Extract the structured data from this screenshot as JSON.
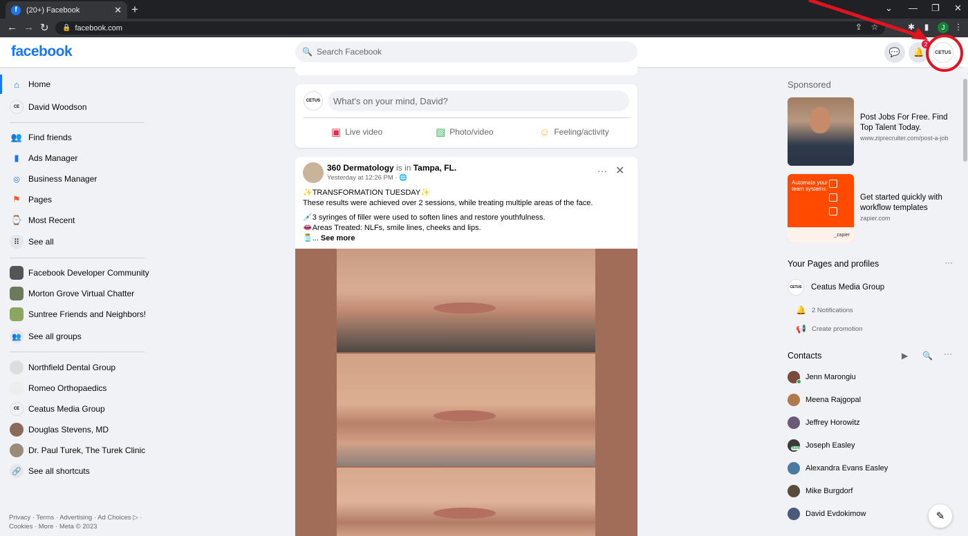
{
  "browser": {
    "tab_title": "(20+) Facebook",
    "tab_favicon": "f",
    "tab_close": "✕",
    "new_tab": "+",
    "url": "facebook.com",
    "profile_initial": "J"
  },
  "header": {
    "logo": "facebook",
    "search_placeholder": "Search Facebook",
    "notif_count": "2",
    "account_avatar_text": "CETUS"
  },
  "left_nav": {
    "items": [
      {
        "label": "Home",
        "icon": "home-icon"
      },
      {
        "label": "David Woodson",
        "icon": "avatar"
      },
      {
        "label": "Find friends",
        "icon": "friends-icon"
      },
      {
        "label": "Ads Manager",
        "icon": "ads-manager-icon"
      },
      {
        "label": "Business Manager",
        "icon": "business-manager-icon"
      },
      {
        "label": "Pages",
        "icon": "pages-flag-icon"
      },
      {
        "label": "Most Recent",
        "icon": "most-recent-icon"
      },
      {
        "label": "See all",
        "icon": "grid-icon"
      }
    ],
    "groups": [
      {
        "label": "Facebook Developer Community"
      },
      {
        "label": "Morton Grove Virtual Chatter"
      },
      {
        "label": "Suntree Friends and Neighbors!"
      },
      {
        "label": "See all groups"
      }
    ],
    "shortcuts": [
      {
        "label": "Northfield Dental Group"
      },
      {
        "label": "Romeo Orthopaedics"
      },
      {
        "label": "Ceatus Media Group"
      },
      {
        "label": "Douglas Stevens, MD"
      },
      {
        "label": "Dr. Paul Turek, The Turek Clinic"
      },
      {
        "label": "See all shortcuts"
      }
    ],
    "footer": "Privacy · Terms · Advertising · Ad Choices ▷ · Cookies · More · Meta © 2023"
  },
  "composer": {
    "avatar_text": "CETUS",
    "placeholder": "What's on your mind, David?",
    "live_video": "Live video",
    "photo_video": "Photo/video",
    "feeling": "Feeling/activity"
  },
  "post": {
    "author": "360 Dermatology",
    "is_in": " is in ",
    "location": "Tampa, FL.",
    "time": "Yesterday at 12:26 PM · ",
    "more": "···",
    "close": "✕",
    "line1": "✨TRANSFORMATION TUESDAY✨",
    "line2": "These results were achieved over 2 sessions, while treating multiple areas of the face.",
    "line3": "💉3 syringes of filler were used to soften lines and restore youthfulness.",
    "line4": "👄Areas Treated: NLFs, smile lines, cheeks and lips.",
    "line5_prefix": "🫙... ",
    "see_more": "See more"
  },
  "right": {
    "sponsored": "Sponsored",
    "ads": [
      {
        "title": "Post Jobs For Free. Find Top Talent Today.",
        "url": "www.ziprecruiter.com/post-a-job"
      },
      {
        "title": "Get started quickly with workflow templates",
        "url": "zapier.com",
        "img_text": "Automate your team systems.",
        "img_footer": "_zapier"
      }
    ],
    "pages_title": "Your Pages and profiles",
    "page_name": "Ceatus Media Group",
    "page_avatar_text": "CETUS",
    "notifications": "2 Notifications",
    "create_promotion": "Create promotion",
    "contacts_title": "Contacts",
    "contacts": [
      {
        "name": "Jenn Marongiu",
        "color": "#7a4a3a"
      },
      {
        "name": "Meena Rajgopal",
        "color": "#b07a4a"
      },
      {
        "name": "Jeffrey Horowitz",
        "color": "#6a5a78"
      },
      {
        "name": "Joseph Easley",
        "color": "#3a3a3a",
        "badge": "41m"
      },
      {
        "name": "Alexandra Evans Easley",
        "color": "#4a7aa0"
      },
      {
        "name": "Mike Burgdorf",
        "color": "#5a4a3a"
      },
      {
        "name": "David Evdokimow",
        "color": "#4a5a7a"
      }
    ]
  },
  "colors": {
    "brand": "#1877f2",
    "annotation_red": "#e0141e"
  }
}
